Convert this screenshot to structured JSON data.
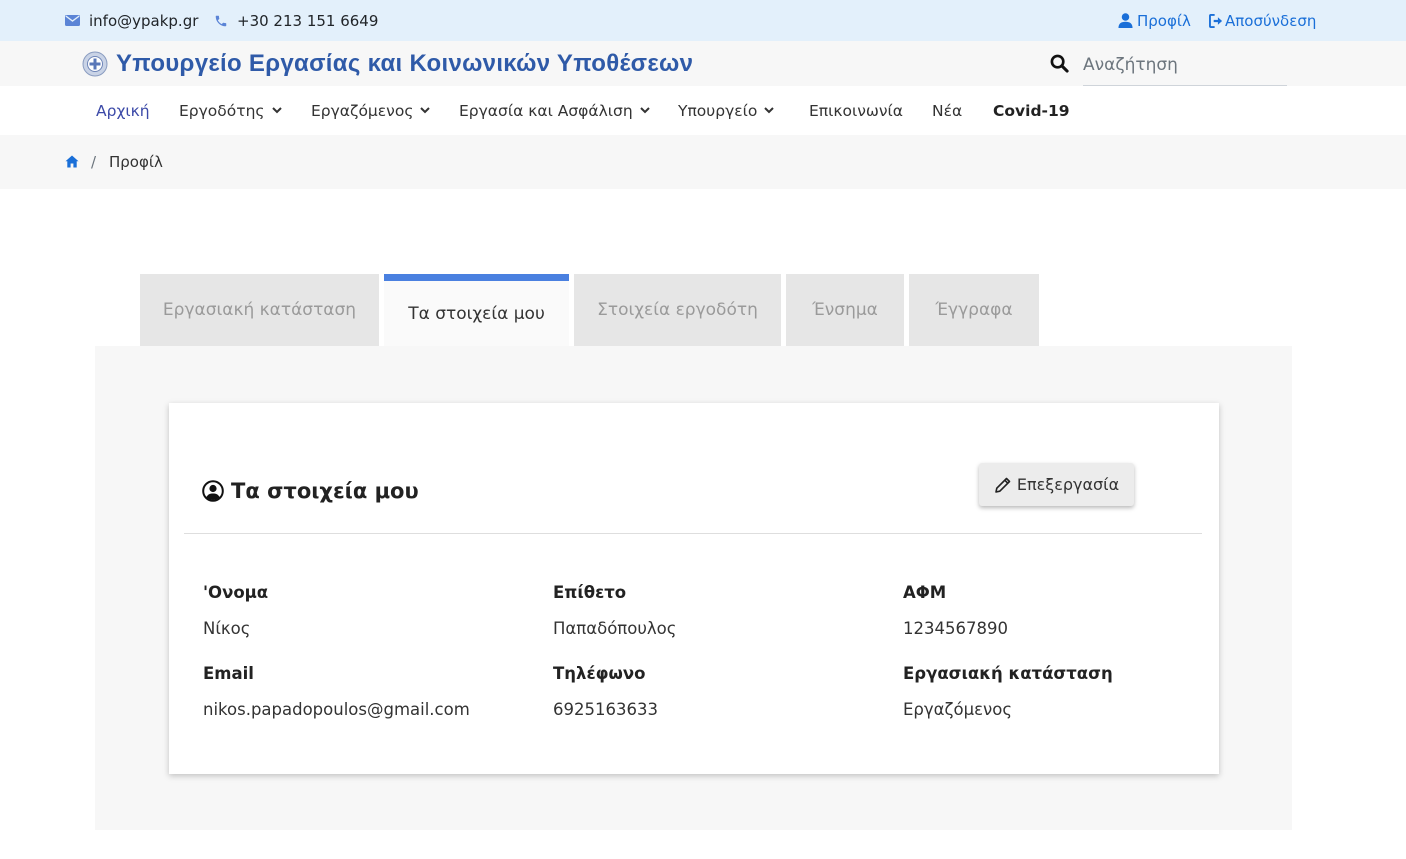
{
  "topbar": {
    "email": "info@ypakp.gr",
    "phone": "+30 213 151 6649",
    "profile_label": "Προφίλ",
    "logout_label": "Αποσύνδεση",
    "email_icon": "envelope-icon",
    "phone_icon": "phone-icon",
    "profile_icon": "user-icon",
    "logout_icon": "sign-out-icon"
  },
  "header": {
    "title": "Υπουργείο Εργασίας και Κοινωνικών Υποθέσεων",
    "logo_icon": "greek-coat-of-arms-icon",
    "search_placeholder": "Αναζήτηση",
    "search_icon": "search-icon"
  },
  "nav": {
    "items": [
      {
        "label": "Αρχική",
        "active": true
      },
      {
        "label": "Εργοδότης",
        "dropdown": true
      },
      {
        "label": "Εργαζόμενος",
        "dropdown": true
      },
      {
        "label": "Εργασία και Ασφάλιση",
        "dropdown": true
      },
      {
        "label": "Υπουργείο",
        "dropdown": true
      },
      {
        "label": "Επικοινωνία"
      },
      {
        "label": "Νέα"
      },
      {
        "label": "Covid-19"
      }
    ]
  },
  "breadcrumb": {
    "home_icon": "home-icon",
    "separator": "/",
    "current": "Προφίλ"
  },
  "tabs": [
    {
      "label": "Εργασιακή κατάσταση"
    },
    {
      "label": "Τα στοιχεία μου",
      "active": true
    },
    {
      "label": "Στοιχεία εργοδότη"
    },
    {
      "label": "Ένσημα"
    },
    {
      "label": "Έγγραφα"
    }
  ],
  "card": {
    "title": "Τα στοιχεία μου",
    "title_icon": "user-circle-icon",
    "edit_label": "Επεξεργασία",
    "edit_icon": "pencil-icon",
    "fields": [
      {
        "label": "'Ονομα",
        "value": "Νίκος"
      },
      {
        "label": "Επίθετο",
        "value": "Παπαδόπουλος"
      },
      {
        "label": "ΑΦΜ",
        "value": "1234567890"
      },
      {
        "label": "Email",
        "value": "nikos.papadopoulos@gmail.com"
      },
      {
        "label": "Τηλέφωνο",
        "value": "6925163633"
      },
      {
        "label": "Εργασιακή κατάσταση",
        "value": "Εργαζόμενος"
      }
    ]
  },
  "colors": {
    "accent": "#1a6fd8",
    "brand": "#2f5aa8",
    "tab_indicator": "#4a80e0",
    "topbar_bg": "#e3f0fb"
  }
}
